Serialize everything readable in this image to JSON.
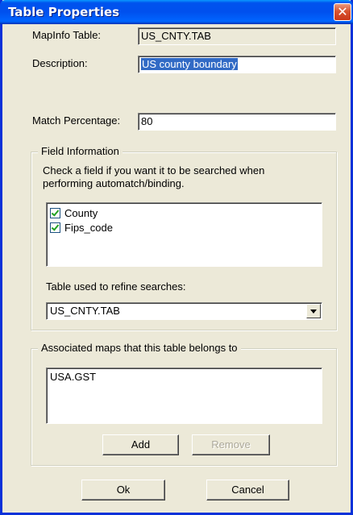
{
  "window": {
    "title": "Table Properties",
    "close_glyph": "✕"
  },
  "form": {
    "mapinfo_table_label": "MapInfo Table:",
    "mapinfo_table_value": "US_CNTY.TAB",
    "description_label": "Description:",
    "description_value": "US county boundary",
    "match_percentage_label": "Match Percentage:",
    "match_percentage_value": "80"
  },
  "field_information": {
    "legend": "Field Information",
    "hint_line1": "Check a field if you want it to be searched when",
    "hint_line2": "performing automatch/binding.",
    "fields": [
      {
        "label": "County",
        "checked": true
      },
      {
        "label": "Fips_code",
        "checked": true
      }
    ],
    "refine_label": "Table used to refine searches:",
    "refine_value": "US_CNTY.TAB"
  },
  "associated_maps": {
    "legend": "Associated maps that this table belongs to",
    "items": [
      "USA.GST"
    ],
    "add_label": "Add",
    "remove_label": "Remove"
  },
  "buttons": {
    "ok_label": "Ok",
    "cancel_label": "Cancel"
  },
  "colors": {
    "titlebar": "#0050ee",
    "dialog_bg": "#ece9d8",
    "selection": "#316ac5",
    "close_button": "#d8532f"
  }
}
